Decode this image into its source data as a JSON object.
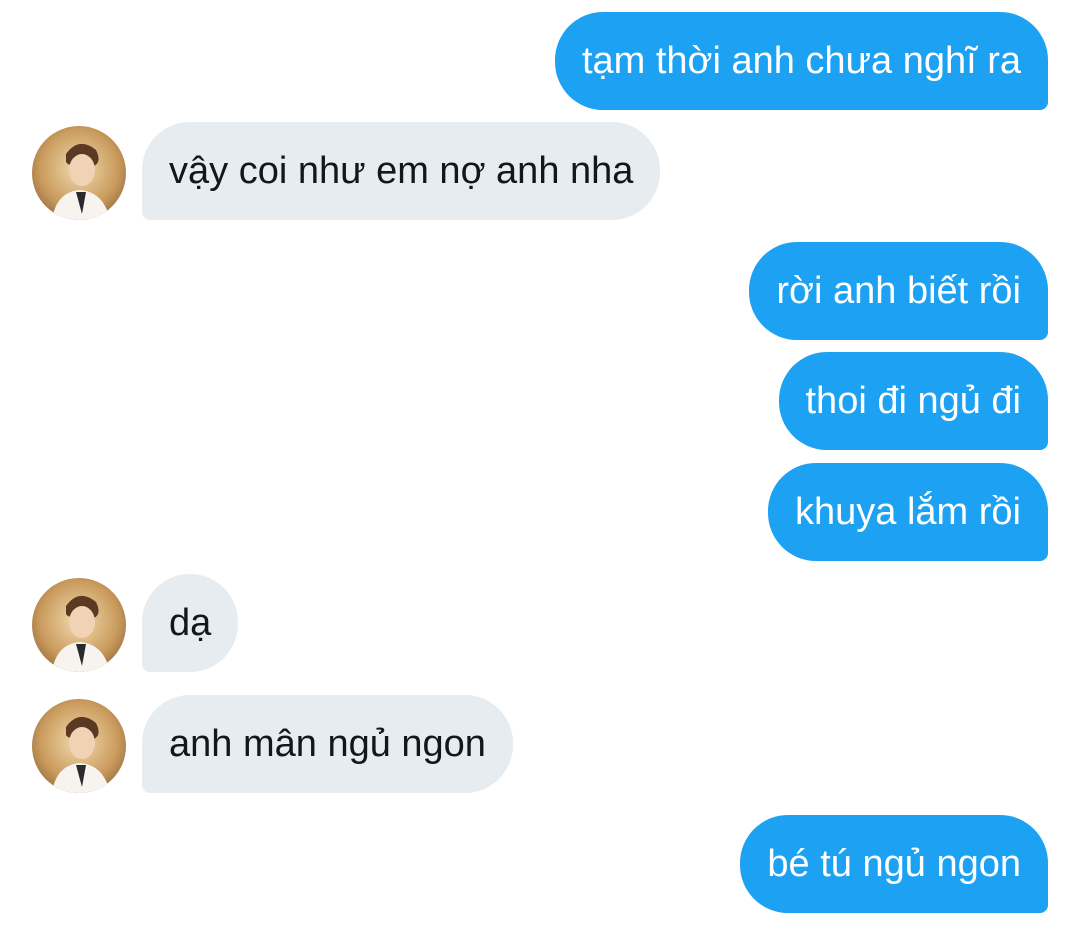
{
  "conversation": {
    "messages": [
      {
        "sender": "me",
        "text": "tạm thời anh chưa nghĩ ra"
      },
      {
        "sender": "contact",
        "text": "vậy coi như em nợ anh nha"
      },
      {
        "sender": "me",
        "text": "rời anh biết rồi"
      },
      {
        "sender": "me",
        "text": "thoi đi ngủ đi"
      },
      {
        "sender": "me",
        "text": "khuya lắm rồi"
      },
      {
        "sender": "contact",
        "text": "dạ"
      },
      {
        "sender": "contact",
        "text": "anh mân ngủ ngon"
      },
      {
        "sender": "me",
        "text": "bé tú ngủ ngon"
      }
    ]
  },
  "colors": {
    "sent_bubble": "#1da1f2",
    "received_bubble": "#e6ecf0",
    "sent_text": "#ffffff",
    "received_text": "#14171a"
  },
  "icons": {
    "contact_avatar": "contact-avatar-photo"
  }
}
